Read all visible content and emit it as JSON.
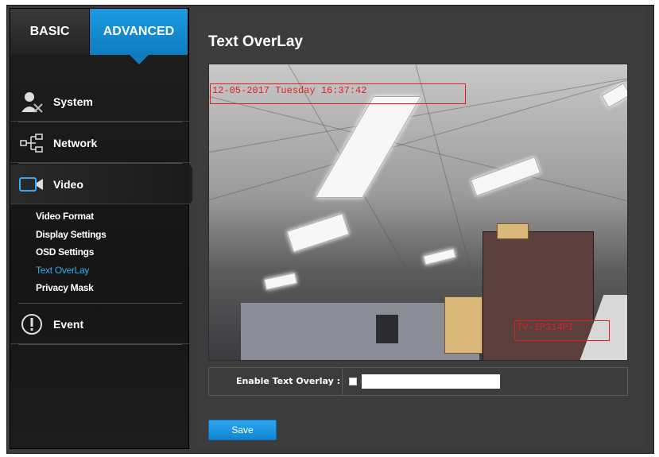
{
  "tabs": [
    {
      "label": "BASIC"
    },
    {
      "label": "ADVANCED"
    }
  ],
  "nav": {
    "system": "System",
    "network": "Network",
    "video": "Video",
    "event": "Event"
  },
  "submenu": [
    {
      "label": "Video Format"
    },
    {
      "label": "Display Settings"
    },
    {
      "label": "OSD Settings"
    },
    {
      "label": "Text OverLay"
    },
    {
      "label": "Privacy Mask"
    }
  ],
  "page": {
    "title": "Text OverLay"
  },
  "video": {
    "osd_top": "12-05-2017  Tuesday  16:37:42",
    "osd_bottom": "TV-IP314PI"
  },
  "settings": {
    "enable_label": "Enable Text Overlay :",
    "text_value": ""
  },
  "buttons": {
    "save": "Save"
  },
  "colors": {
    "accent": "#1a9be0",
    "osd": "#e02020"
  }
}
